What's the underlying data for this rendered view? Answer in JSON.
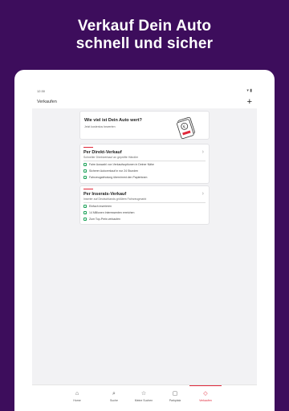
{
  "headline": [
    "Verkauf Dein Auto",
    "schnell und sicher"
  ],
  "statusbar": {
    "time": "12:30",
    "icons": "▾ ▮"
  },
  "appbar": {
    "title": "Verkaufen",
    "add_label": "+"
  },
  "valuation_card": {
    "title": "Wie viel ist Dein Auto wert?",
    "subtitle": "Jetzt kostenlos bewerten"
  },
  "direct_sale": {
    "title": "Per Direkt-Verkauf",
    "subtitle": "Schneller Direktverkauf an geprüfte Händler",
    "features": [
      "Faire Auswahl von Verkaufsoptionen in Deiner Nähe",
      "Sicherer Autoverkauf in nur 24 Stunden",
      "Fahrzeugabholung übernimmt den Papierkram"
    ]
  },
  "listing_sale": {
    "title": "Per Inserats-Verkauf",
    "subtitle": "Inserier auf Deutschlands größtem Fahrzeugmarkt",
    "features": [
      "Einfach inserieren",
      "14 Millionen Interessenten erreichen",
      "Zum Top-Preis verkaufen"
    ]
  },
  "nav": [
    {
      "label": "Home",
      "icon": "home-icon"
    },
    {
      "label": "Suche",
      "icon": "search-icon"
    },
    {
      "label": "Meine Suchen",
      "icon": "star-icon"
    },
    {
      "label": "Parkplatz",
      "icon": "parking-icon"
    },
    {
      "label": "Verkaufen",
      "icon": "tag-icon"
    }
  ],
  "colors": {
    "background": "#3d0d5c",
    "accent": "#e0283a",
    "check": "#1ea35a"
  }
}
